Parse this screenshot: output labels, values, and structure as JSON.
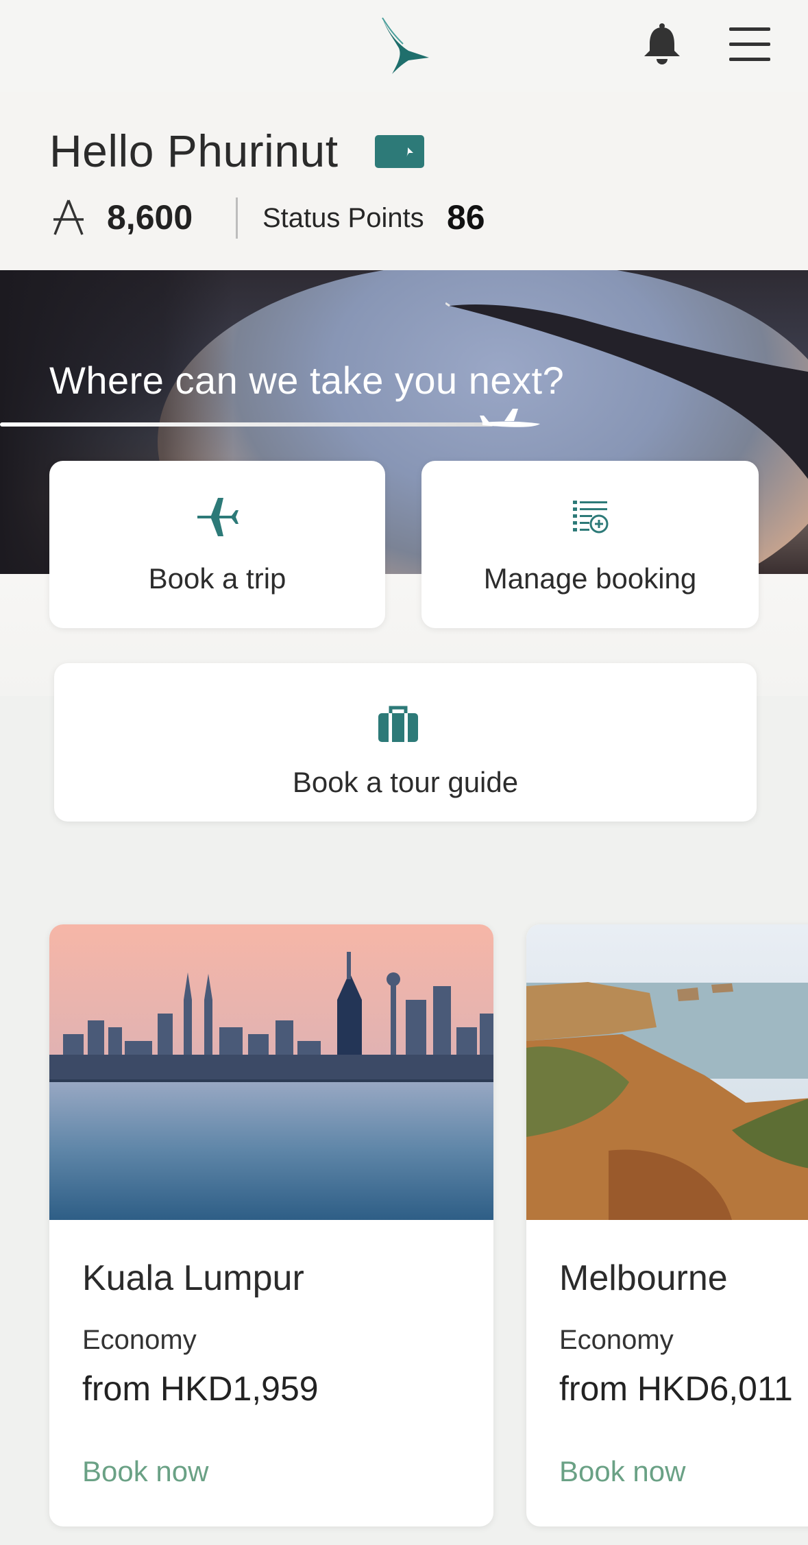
{
  "header": {
    "logo_icon": "brushwing-logo-icon",
    "notification_icon": "bell-icon",
    "menu_icon": "hamburger-menu-icon"
  },
  "greeting": {
    "hello_text": "Hello Phurinut",
    "membership_card_icon": "membership-card-icon",
    "miles_icon": "asia-miles-icon",
    "miles_value": "8,600",
    "status_label": "Status Points",
    "status_value": "86"
  },
  "hero": {
    "title": "Where can we take you next?"
  },
  "actions": {
    "book_trip": "Book a trip",
    "manage_booking": "Manage booking",
    "tour_guide": "Book a tour guide"
  },
  "destinations": [
    {
      "city": "Kuala Lumpur",
      "cabin": "Economy",
      "price": "from HKD1,959",
      "cta": "Book now"
    },
    {
      "city": "Melbourne",
      "cabin": "Economy",
      "price": "from HKD6,011",
      "cta": "Book now"
    }
  ],
  "colors": {
    "brand_teal": "#2d7a78",
    "cta_green": "#6aa185",
    "background": "#f0f1ef"
  }
}
